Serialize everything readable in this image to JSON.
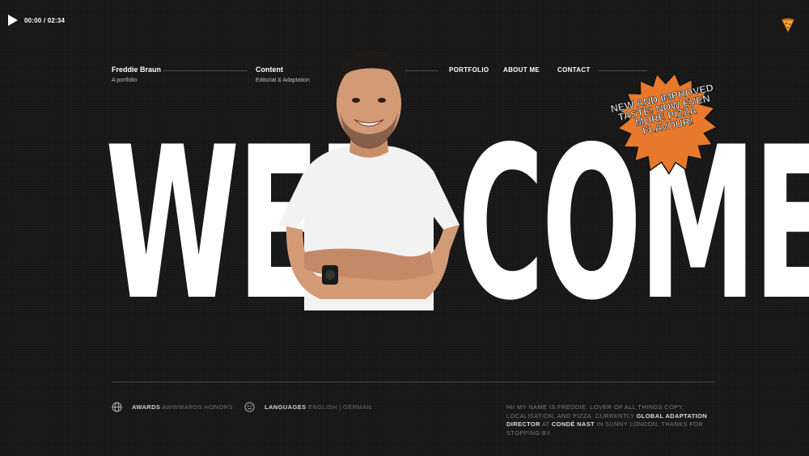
{
  "player": {
    "time": "00:00 / 02:34"
  },
  "header": {
    "name": "Freddie Braun",
    "tagline": "A portfolio",
    "section": "Content",
    "section_sub": "Editorial & Adaptation",
    "nav": [
      "PORTFOLIO",
      "ABOUT ME",
      "CONTACT"
    ]
  },
  "hero": {
    "word_left": "WEL",
    "word_right": "COME",
    "sticker": "NEW AND IMPROVED TASTE! NOW EVEN MORE PIZZA FLAVOUR!"
  },
  "footer": {
    "awards_label": "AWARDS",
    "awards_value": "AWWWARDS HONORS",
    "languages_label": "LANGUAGES",
    "languages_value": "ENGLISH | GERMAN",
    "bio_1": "HI! MY NAME IS FREDDIE. LOVER OF ALL THINGS COPY, LOCALISATION, AND PIZZA. CURRENTLY ",
    "bio_role": "GLOBAL ADAPTATION DIRECTOR",
    "bio_2": " AT ",
    "bio_company": "CONDÉ NAST",
    "bio_3": " IN SUNNY LONDON. THANKS FOR STOPPING BY."
  },
  "colors": {
    "background": "#161616",
    "accent": "#e8792c",
    "text": "#ffffff"
  },
  "icons": [
    "play-icon",
    "pizza-icon",
    "globe-icon",
    "smile-icon"
  ]
}
